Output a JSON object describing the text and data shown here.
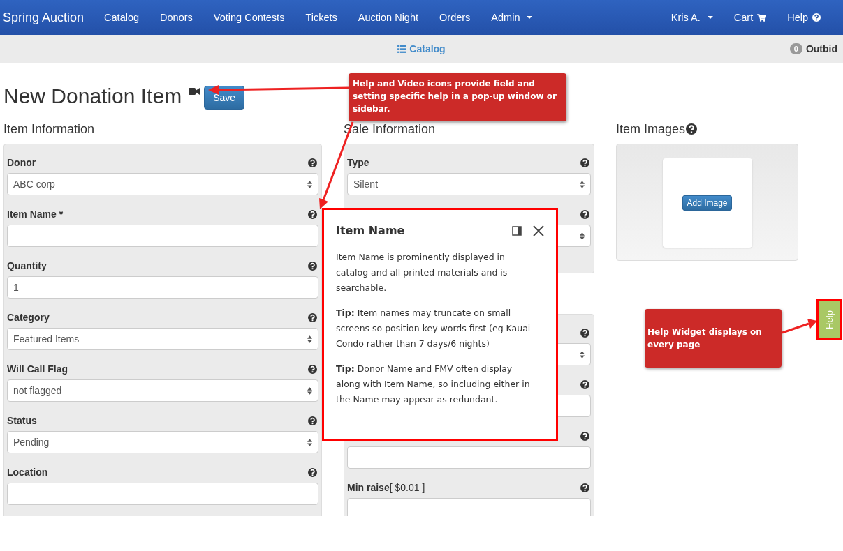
{
  "navbar": {
    "brand": "Spring Auction",
    "items": [
      {
        "label": "Catalog",
        "dropdown": false
      },
      {
        "label": "Donors",
        "dropdown": false
      },
      {
        "label": "Voting Contests",
        "dropdown": false
      },
      {
        "label": "Tickets",
        "dropdown": false
      },
      {
        "label": "Auction Night",
        "dropdown": false
      },
      {
        "label": "Orders",
        "dropdown": false
      },
      {
        "label": "Admin",
        "dropdown": true
      }
    ],
    "right_items": [
      {
        "label": "Kris A.",
        "kind": "dropdown"
      },
      {
        "label": "Cart",
        "kind": "cart"
      },
      {
        "label": "Help",
        "kind": "help"
      }
    ]
  },
  "subbar": {
    "link": "Catalog",
    "badge": "0",
    "badge_label": "Outbid"
  },
  "page": {
    "title": "New Donation Item",
    "save_button": "Save"
  },
  "sections": [
    {
      "title": "Item Information",
      "panels": [
        {
          "fields": [
            {
              "kind": "select",
              "label": "Donor",
              "value": "ABC corp"
            },
            {
              "kind": "input",
              "label": "Item Name *"
            },
            {
              "kind": "input",
              "label": "Quantity",
              "value": "1"
            },
            {
              "kind": "select",
              "label": "Category",
              "value": "Featured Items"
            },
            {
              "kind": "select",
              "label": "Will Call Flag",
              "value": "not flagged"
            },
            {
              "kind": "select",
              "label": "Status",
              "value": "Pending"
            },
            {
              "kind": "input",
              "label": "Location"
            }
          ]
        }
      ]
    },
    {
      "title": "Sale Information",
      "panels": [
        {
          "fields": [
            {
              "kind": "select",
              "label": "Type",
              "value": "Silent"
            },
            {
              "kind": "select"
            }
          ]
        },
        {
          "fields": [
            {
              "kind": "select"
            },
            {
              "kind": "input"
            },
            {
              "kind": "input"
            },
            {
              "kind": "input",
              "label": "Min raise",
              "hint": "[ $0.01 ]"
            }
          ]
        }
      ]
    }
  ],
  "images": {
    "title": "Item Images",
    "button": "Add Image"
  },
  "help_popup": {
    "title": "Item Name",
    "paragraphs": [
      "Item Name is prominently displayed in catalog and all printed materials and is searchable.",
      "**Tip:** Item names may truncate on small screens so position key words first (eg Kauai Condo rather than 7 days/6 nights)",
      "**Tip:** Donor Name and FMV often display along with Item Name, so including either in the Name may appear as redundant."
    ]
  },
  "annotations": [
    "Help and Video icons provide field and setting specific help in a pop-up window or sidebar.",
    "Help Widget displays on every page"
  ],
  "help_tab": {
    "label": "Help"
  }
}
